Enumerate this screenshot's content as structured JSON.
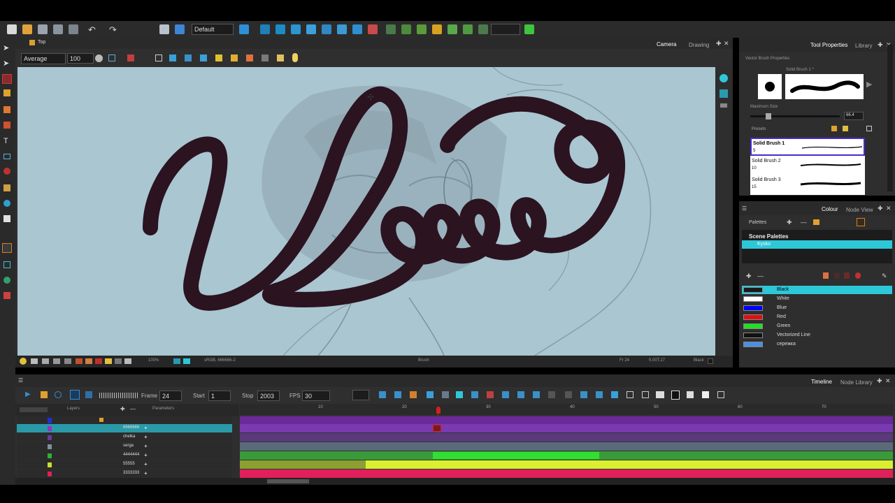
{
  "toolbar": {
    "workspace_select": "Default",
    "empty_select": ""
  },
  "view": {
    "tab_label": "Top",
    "camera_tab": "Camera",
    "drawing_tab": "Drawing",
    "brush_mode": "Average",
    "brush_size": "100",
    "status_zoom": "100%",
    "status_colorspace": "sRGB, 666666-2",
    "status_tool": "Brush",
    "status_frame": "Fr 24",
    "status_coords": "5.00T,17",
    "status_color": "Black"
  },
  "tool_properties": {
    "tab_tool_properties": "Tool Properties",
    "tab_library": "Library",
    "title": "Vector Brush Properties",
    "preset_name_top": "Solid Brush 1 *",
    "max_size_label": "Maximum Size",
    "max_size_value": "66.4",
    "presets_label": "Presets",
    "presets": [
      {
        "name": "Solid Brush 1",
        "size": "5"
      },
      {
        "name": "Solid Brush 2",
        "size": "10"
      },
      {
        "name": "Solid Brush 3",
        "size": "15"
      }
    ]
  },
  "colour": {
    "tab_colour": "Colour",
    "tab_node_view": "Node View",
    "palettes_label": "Palettes",
    "scene_palettes_label": "Scene Palettes",
    "palette_name": "Kysko",
    "colors": [
      {
        "name": "Black",
        "hex": "#1a1a1a"
      },
      {
        "name": "White",
        "hex": "#ffffff"
      },
      {
        "name": "Blue",
        "hex": "#0000ff"
      },
      {
        "name": "Red",
        "hex": "#e01010"
      },
      {
        "name": "Green",
        "hex": "#20e020"
      },
      {
        "name": "Vectorized Line",
        "hex": "#111111"
      },
      {
        "name": "сережка",
        "hex": "#4a90e2"
      }
    ]
  },
  "timeline": {
    "tab_timeline": "Timeline",
    "tab_node_library": "Node Library",
    "frame_label": "Frame",
    "frame_value": "24",
    "start_label": "Start",
    "start_value": "1",
    "stop_label": "Stop",
    "stop_value": "2003",
    "fps_label": "FPS",
    "fps_value": "30",
    "layers_header": "Layers",
    "parameters_header": "Parameters",
    "ruler": [
      "10",
      "20",
      "30",
      "40",
      "50",
      "60",
      "70"
    ],
    "layers": [
      {
        "name": "6666666",
        "color": "#8a3fc0"
      },
      {
        "name": "chelka",
        "color": "#6a3a9a"
      },
      {
        "name": "serga",
        "color": "#8090a0"
      },
      {
        "name": "4444444",
        "color": "#30b030"
      },
      {
        "name": "55555",
        "color": "#c8e030"
      },
      {
        "name": "3333333",
        "color": "#e0205a"
      }
    ]
  },
  "colors": {
    "accent_cyan": "#2ec7d8",
    "stroke": "#2b1320",
    "canvas_bg": "#a9c6d1"
  }
}
